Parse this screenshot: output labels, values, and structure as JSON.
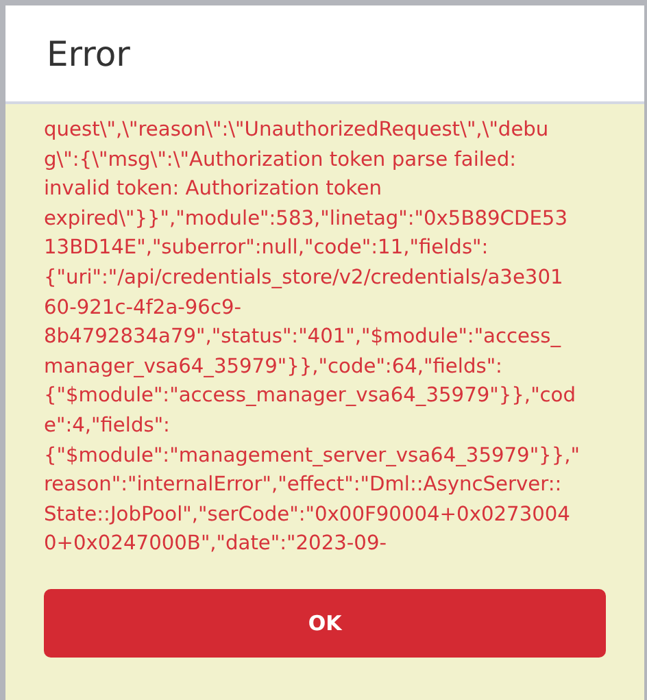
{
  "dialog": {
    "title": "Error",
    "message_lines": [
      "quest\\\",\\\"reason\\\":\\\"UnauthorizedRequest\\\",\\\"debu",
      "g\\\":{\\\"msg\\\":\\\"Authorization token parse failed:",
      "invalid token: Authorization token",
      "expired\\\"}}\",\"module\":583,\"linetag\":\"0x5B89CDE53",
      "13BD14E\",\"suberror\":null,\"code\":11,\"fields\":",
      "{\"uri\":\"/api/credentials_store/v2/credentials/a3e301",
      "60-921c-4f2a-96c9-",
      "8b4792834a79\",\"status\":\"401\",\"$module\":\"access_",
      "manager_vsa64_35979\"}},\"code\":64,\"fields\":",
      "{\"$module\":\"access_manager_vsa64_35979\"}},\"cod",
      "e\":4,\"fields\":",
      "{\"$module\":\"management_server_vsa64_35979\"}},\"",
      "reason\":\"internalError\",\"effect\":\"Dml::AsyncServer::",
      "State::JobPool\",\"serCode\":\"0x00F90004+0x0273004",
      "0+0x0247000B\",\"date\":\"2023-09-"
    ],
    "buttons": [
      "OK"
    ]
  }
}
